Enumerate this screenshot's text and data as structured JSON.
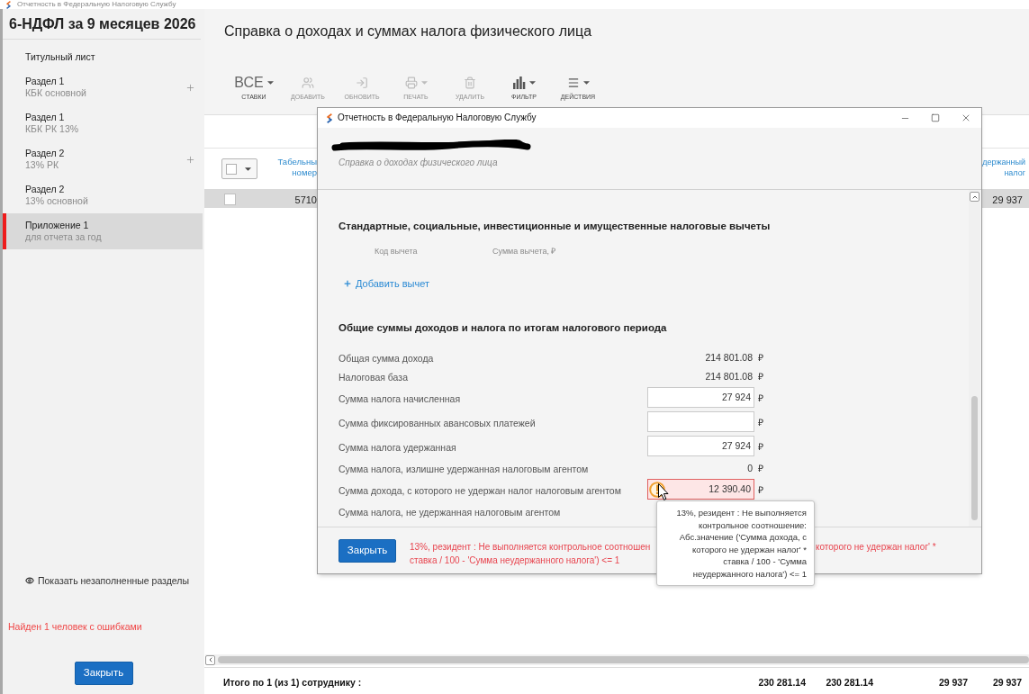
{
  "app_bar": {
    "title": "Отчетность в Федеральную Налоговую Службу"
  },
  "sidebar": {
    "title": "6-НДФЛ за 9 месяцев 2026",
    "items": [
      {
        "label": "Титульный лист",
        "selected": false,
        "addable": false
      },
      {
        "label": "Раздел 1",
        "sublabel": "КБК основной",
        "selected": false,
        "addable": true
      },
      {
        "label": "Раздел 1",
        "sublabel": "КБК РК 13%",
        "selected": false,
        "addable": false
      },
      {
        "label": "Раздел 2",
        "sublabel": "13% РК",
        "selected": false,
        "addable": true
      },
      {
        "label": "Раздел 2",
        "sublabel": "13% основной",
        "selected": false,
        "addable": false
      },
      {
        "label": "Приложение 1",
        "sublabel": "для отчета за год",
        "selected": true,
        "addable": false
      }
    ],
    "show_empty_link": "Показать незаполненные разделы",
    "error_summary": "Найден 1 человек с ошибками",
    "close_button": "Закрыть"
  },
  "main": {
    "title": "Справка о доходах и суммах налога физического лица",
    "toolbar": [
      {
        "kind": "select",
        "value": "ВСЕ",
        "label": "СТАВКИ",
        "disabled": false,
        "dropdown": true
      },
      {
        "kind": "button",
        "label": "ДОБАВИТЬ",
        "disabled": true,
        "dropdown": false
      },
      {
        "kind": "button",
        "label": "ОБНОВИТЬ",
        "disabled": true,
        "dropdown": false
      },
      {
        "kind": "button",
        "label": "ПЕЧАТЬ",
        "disabled": true,
        "dropdown": true
      },
      {
        "kind": "button",
        "label": "УДАЛИТЬ",
        "disabled": true,
        "dropdown": false
      },
      {
        "kind": "button",
        "label": "ФИЛЬТР",
        "disabled": false,
        "dropdown": true
      },
      {
        "kind": "button",
        "label": "ДЕЙСТВИЯ",
        "disabled": false,
        "dropdown": true
      }
    ],
    "table": {
      "select_all": {
        "checked": false
      },
      "columns": [
        {
          "heading": "Табельны\nномер"
        },
        {
          "heading": "держанный\nналог"
        }
      ],
      "rows": [
        {
          "selected": true,
          "checked": false,
          "cells": [
            "5710",
            "29 937"
          ]
        }
      ]
    },
    "totals": {
      "label": "Итого по 1 (из 1) сотруднику :",
      "values": [
        "230 281.14",
        "230 281.14",
        "29 937",
        "29 937"
      ]
    }
  },
  "dialog": {
    "title": "Отчетность в Федеральную Налоговую Службу",
    "name_redacted": true,
    "subtitle": "Справка о доходах физического лица",
    "deductions": {
      "heading": "Стандартные, социальные, инвестиционные и имущественные налоговые вычеты",
      "columns": [
        "Код вычета",
        "Сумма вычета, ₽"
      ],
      "add_link": "Добавить вычет"
    },
    "totals": {
      "heading": "Общие суммы доходов и налога по итогам налогового периода",
      "rows": [
        {
          "label": "Общая сумма дохода",
          "kind": "text",
          "value": "214 801.08",
          "currency": "₽"
        },
        {
          "label": "Налоговая база",
          "kind": "text",
          "value": "214 801.08",
          "currency": "₽"
        },
        {
          "label": "Сумма налога начисленная",
          "kind": "input",
          "value": "27 924",
          "currency": "₽",
          "error": false
        },
        {
          "label": "Сумма фиксированных авансовых платежей",
          "kind": "input",
          "currency": "₽",
          "error": false
        },
        {
          "label": "Сумма налога удержанная",
          "kind": "input",
          "value": "27 924",
          "currency": "₽",
          "error": false
        },
        {
          "label": "Сумма налога, излишне удержанная налоговым агентом",
          "kind": "text",
          "value": "0",
          "currency": "₽"
        },
        {
          "label": "Сумма дохода, с которого не удержан налог налоговым агентом",
          "kind": "input",
          "value": "12 390.40",
          "currency": "₽",
          "error": true
        },
        {
          "label": "Сумма налога, не удержанная налоговым агентом",
          "kind": "text"
        }
      ]
    },
    "close_button": "Закрыть",
    "error_message": {
      "line_1_start": "13%, резидент : Не выполняется контрольное соотношен",
      "line_1_end": "которого не удержан налог' *",
      "line_2": "ставка / 100 - 'Сумма неудержанного налога') <= 1"
    }
  },
  "tooltip": {
    "text": "13%, резидент : Не выполняется контрольное соотношение: Абс.значение ('Сумма дохода, с которого не удержан налог' * ставка / 100 - 'Сумма неудержанного налога') <= 1"
  }
}
